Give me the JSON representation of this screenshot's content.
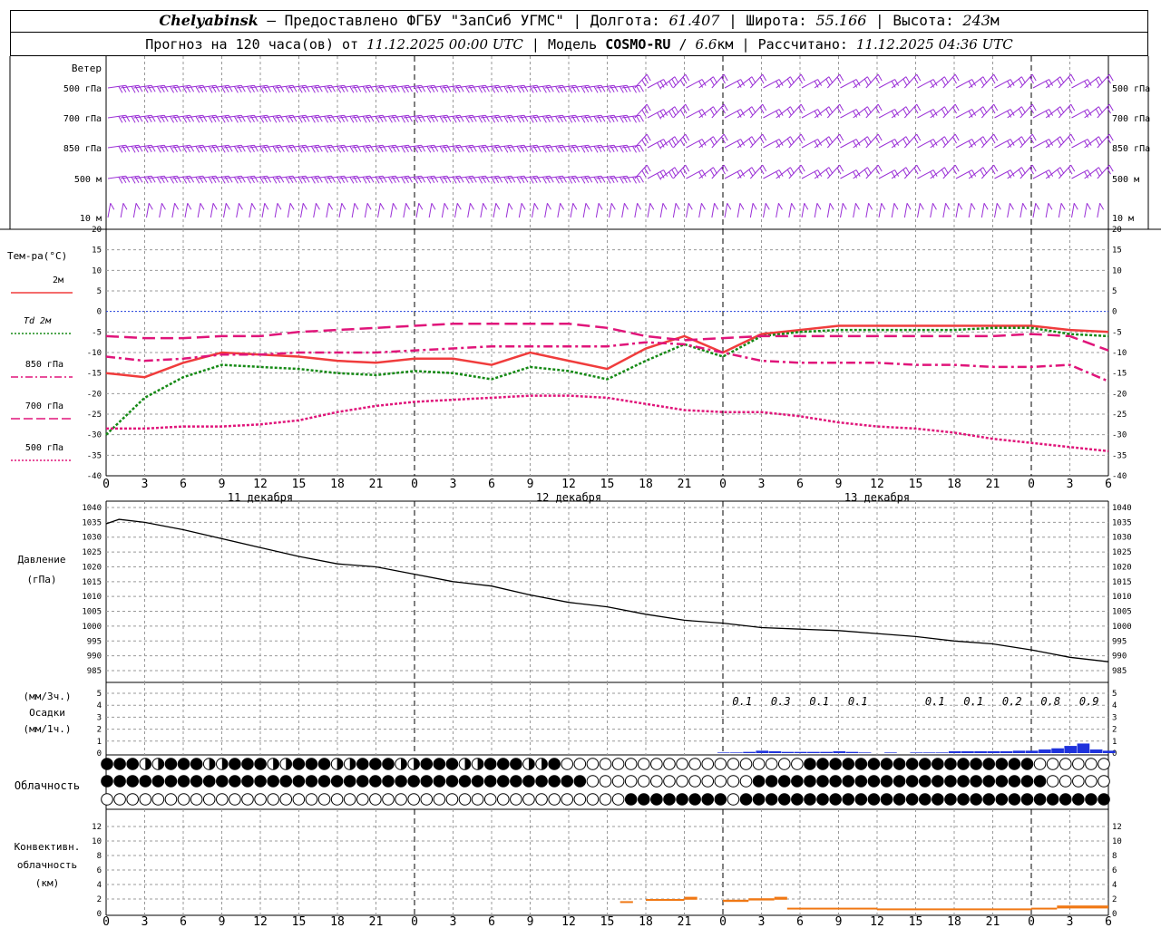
{
  "header": {
    "city": "Chelyabinsk",
    "dash": "—",
    "provider": "Предоставлено ФГБУ \"ЗапСиб УГМС\"",
    "lon_label": "Долгота:",
    "lon": "61.407",
    "lat_label": "Широта:",
    "lat": "55.166",
    "alt_label": "Высота:",
    "alt": "243",
    "alt_unit": "м",
    "forecast_prefix": "Прогноз на 120 часа(ов) от",
    "forecast_start": "11.12.2025 00:00 UTC",
    "model_label": "Модель",
    "model": "COSMO-RU",
    "resolution": "6.6",
    "resolution_unit": "км",
    "computed_label": "Рассчитано:",
    "computed": "11.12.2025 04:36 UTC"
  },
  "colors": {
    "wind_barb": "#9a2fd6",
    "temp_2m": "#f03c3c",
    "td_2m": "#158a15",
    "t850": "#e0157a",
    "t700": "#e0157a",
    "t500": "#e0157a",
    "zero_line": "#1e3cdc",
    "precip": "#1e32dc",
    "convective": "#f07814",
    "grid": "#999999"
  },
  "time_axis": {
    "hour_ticks": [
      "0",
      "3",
      "6",
      "9",
      "12",
      "15",
      "18",
      "21",
      "0",
      "3",
      "6",
      "9",
      "12",
      "15",
      "18",
      "21",
      "0",
      "3",
      "6",
      "9",
      "12",
      "15",
      "18",
      "21",
      "0",
      "3",
      "6"
    ],
    "dates": [
      "11 декабря",
      "12 декабря",
      "13 декабря"
    ]
  },
  "wind_panel": {
    "title": "Ветер",
    "levels": [
      "500 гПа",
      "700 гПа",
      "850 гПа",
      "500 м",
      "10 м"
    ],
    "right_levels": [
      "500 гПа",
      "700 гПа",
      "850 гПа",
      "500 м",
      "10 м"
    ]
  },
  "temp_panel": {
    "title": "Тем-ра(°C)",
    "legend": [
      {
        "label": "2м",
        "key": "temp_2m",
        "style": "solid"
      },
      {
        "label": "Td  2м",
        "key": "td_2m",
        "style": "dotted"
      },
      {
        "label": "850 гПа",
        "key": "t850",
        "style": "dashdot"
      },
      {
        "label": "700 гПа",
        "key": "t700",
        "style": "dashed"
      },
      {
        "label": "500 гПа",
        "key": "t500",
        "style": "dotted"
      }
    ],
    "ticks": [
      "20",
      "15",
      "10",
      "5",
      "0",
      "-5",
      "-10",
      "-15",
      "-20",
      "-25",
      "-30",
      "-35",
      "-40"
    ]
  },
  "pressure_panel": {
    "title_1": "Давление",
    "title_2": "(гПа)",
    "ticks": [
      "1040",
      "1035",
      "1030",
      "1025",
      "1020",
      "1015",
      "1010",
      "1005",
      "1000",
      "995",
      "990",
      "985"
    ]
  },
  "precip_panel": {
    "title_1": "(мм/3ч.)",
    "title_2": "Осадки",
    "title_3": "(мм/1ч.)",
    "ticks": [
      "5",
      "4",
      "3",
      "2",
      "1",
      "0"
    ],
    "totals": [
      "0.1",
      "0.3",
      "0.1",
      "0.1",
      "0.1",
      "0.1",
      "0.2",
      "0.8",
      "0.9"
    ]
  },
  "cloud_panel": {
    "title": "Облачность"
  },
  "conv_panel": {
    "title_1": "Конвективн.",
    "title_2": "облачность",
    "title_3": "(км)",
    "ticks": [
      "12",
      "10",
      "8",
      "6",
      "4",
      "2",
      "0"
    ]
  },
  "chart_data": [
    {
      "type": "line",
      "title": "Тем-ра(°C)",
      "x_unit": "hours since 11.12.2025 00:00 UTC",
      "ylim": [
        -40,
        20
      ],
      "x": [
        0,
        3,
        6,
        9,
        12,
        15,
        18,
        21,
        24,
        27,
        30,
        33,
        36,
        39,
        42,
        45,
        48,
        51,
        54,
        57,
        60,
        63,
        66,
        69,
        72,
        75,
        78
      ],
      "series": [
        {
          "name": "2м",
          "values": [
            -15,
            -16,
            -12.5,
            -10,
            -10.5,
            -11,
            -12,
            -12.5,
            -11.5,
            -11.5,
            -13,
            -10,
            -12,
            -14,
            -9,
            -6,
            -10,
            -5.5,
            -4.5,
            -3.5,
            -3.5,
            -3.5,
            -3.5,
            -3.5,
            -3.5,
            -4.5,
            -5
          ]
        },
        {
          "name": "Td  2м",
          "values": [
            -30,
            -21,
            -16,
            -13,
            -13.5,
            -14,
            -15,
            -15.5,
            -14.5,
            -15,
            -16.5,
            -13.5,
            -14.5,
            -16.5,
            -12,
            -8,
            -11,
            -6,
            -5,
            -4.5,
            -4.5,
            -4.5,
            -4.5,
            -4,
            -4,
            -5.5,
            -6
          ]
        },
        {
          "name": "850 гПа",
          "values": [
            -11,
            -12,
            -11.5,
            -10.5,
            -10.5,
            -10,
            -10,
            -10,
            -9.5,
            -9,
            -8.5,
            -8.5,
            -8.5,
            -8.5,
            -7.5,
            -8,
            -10,
            -12,
            -12.5,
            -12.5,
            -12.5,
            -13,
            -13,
            -13.5,
            -13.5,
            -13,
            -17
          ]
        },
        {
          "name": "700 гПа",
          "values": [
            -6,
            -6.5,
            -6.5,
            -6,
            -6,
            -5,
            -4.5,
            -4,
            -3.5,
            -3,
            -3,
            -3,
            -3,
            -4,
            -6,
            -7,
            -6.5,
            -6,
            -6,
            -6,
            -6,
            -6,
            -6,
            -6,
            -5.5,
            -6,
            -9.5
          ]
        },
        {
          "name": "500 гПа",
          "values": [
            -28.5,
            -28.5,
            -28,
            -28,
            -27.5,
            -26.5,
            -24.5,
            -23,
            -22,
            -21.5,
            -21,
            -20.5,
            -20.5,
            -21,
            -22.5,
            -24,
            -24.5,
            -24.5,
            -25.5,
            -27,
            -28,
            -28.5,
            -29.5,
            -31,
            -32,
            -33,
            -34
          ]
        }
      ]
    },
    {
      "type": "line",
      "title": "Давление (гПа)",
      "x_unit": "hours since 11.12.2025 00:00 UTC",
      "ylim": [
        985,
        1040
      ],
      "x": [
        0,
        1,
        3,
        6,
        9,
        12,
        15,
        18,
        21,
        24,
        27,
        30,
        33,
        36,
        39,
        42,
        45,
        48,
        51,
        54,
        57,
        60,
        63,
        66,
        69,
        72,
        75,
        78
      ],
      "series": [
        {
          "name": "",
          "values": [
            1034.5,
            1036,
            1035,
            1032.5,
            1029.5,
            1026.5,
            1023.5,
            1021,
            1020,
            1017.5,
            1015,
            1013.5,
            1010.5,
            1008,
            1006.5,
            1004,
            1002,
            1001,
            999.5,
            999,
            998.5,
            997.5,
            996.5,
            995,
            994,
            992,
            989.5,
            988
          ]
        }
      ]
    },
    {
      "type": "bar",
      "title": "Осадки",
      "x_unit": "hours since 11.12.2025 00:00 UTC",
      "ylim": [
        0,
        5
      ],
      "x": [
        48,
        49,
        50,
        51,
        52,
        53,
        54,
        55,
        56,
        57,
        58,
        59,
        60,
        61,
        62,
        63,
        64,
        65,
        66,
        67,
        68,
        69,
        70,
        71,
        72,
        73,
        74,
        75,
        76,
        77,
        78
      ],
      "values": [
        0.05,
        0.05,
        0.1,
        0.2,
        0.15,
        0.1,
        0.1,
        0.1,
        0.1,
        0.15,
        0.1,
        0.05,
        0,
        0.05,
        0,
        0.05,
        0.05,
        0.05,
        0.15,
        0.15,
        0.15,
        0.15,
        0.15,
        0.2,
        0.2,
        0.3,
        0.4,
        0.6,
        0.8,
        0.3,
        0.2
      ]
    },
    {
      "type": "bar",
      "title": "Конвективн. облачность (км)",
      "x_unit": "hours since 11.12.2025 00:00 UTC",
      "ylim": [
        0,
        14
      ],
      "segments": [
        {
          "x0": 40,
          "x1": 41,
          "base": 1.5,
          "top": 1.7
        },
        {
          "x0": 42,
          "x1": 45,
          "base": 1.8,
          "top": 2.0
        },
        {
          "x0": 45,
          "x1": 46,
          "base": 1.9,
          "top": 2.3
        },
        {
          "x0": 48,
          "x1": 50,
          "base": 1.6,
          "top": 1.9
        },
        {
          "x0": 50,
          "x1": 52,
          "base": 1.8,
          "top": 2.1
        },
        {
          "x0": 52,
          "x1": 53,
          "base": 1.9,
          "top": 2.3
        },
        {
          "x0": 53,
          "x1": 60,
          "base": 0.6,
          "top": 0.8
        },
        {
          "x0": 60,
          "x1": 72,
          "base": 0.6,
          "top": 0.7
        },
        {
          "x0": 72,
          "x1": 74,
          "base": 0.6,
          "top": 0.8
        },
        {
          "x0": 74,
          "x1": 78,
          "base": 0.7,
          "top": 1.1
        }
      ]
    }
  ]
}
